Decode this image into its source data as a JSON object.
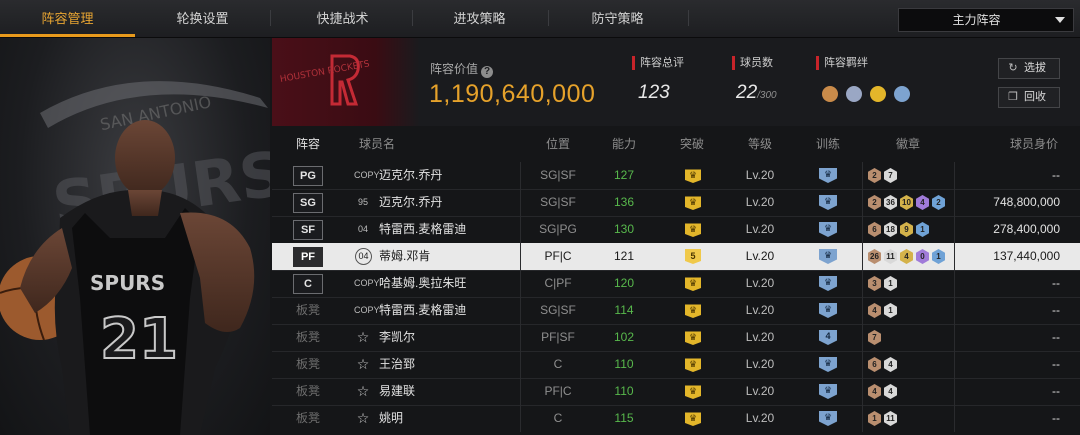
{
  "tabs": [
    {
      "label": "阵容管理",
      "active": true
    },
    {
      "label": "轮换设置"
    },
    {
      "label": "快捷战术"
    },
    {
      "label": "进攻策略"
    },
    {
      "label": "防守策略"
    }
  ],
  "lineup_select": {
    "value": "主力阵容"
  },
  "team": {
    "logo_text": "HOUSTON ROCKETS",
    "value_label": "阵容价值",
    "value": "1,190,640,000",
    "overall_label": "阵容总评",
    "overall": "123",
    "players_label": "球员数",
    "players": "22",
    "players_cap": "/300",
    "bonds_label": "阵容羁绊",
    "bond_colors": [
      "#c98b4a",
      "#9aa7c4",
      "#e3b62a",
      "#7da3cf"
    ]
  },
  "buttons": {
    "select": "选拔",
    "recycle": "回收"
  },
  "table": {
    "headers": {
      "slot": "阵容",
      "player": "球员名",
      "position": "位置",
      "ability": "能力",
      "breakthrough": "突破",
      "level": "等级",
      "training": "训练",
      "badges": "徽章",
      "value": "球员身价"
    },
    "rows": [
      {
        "slot": "PG",
        "tag": "COPY",
        "name": "迈克尔.乔丹",
        "position": "SG|SF",
        "ability": "127",
        "crown": "",
        "level": "Lv.20",
        "train": "",
        "badges": [
          {
            "c": "#b98e6f",
            "t": "2"
          },
          {
            "c": "#d9d9d9",
            "t": "7"
          }
        ],
        "price": "--"
      },
      {
        "slot": "SG",
        "tag": "95",
        "name": "迈克尔.乔丹",
        "position": "SG|SF",
        "ability": "136",
        "crown": "",
        "level": "Lv.20",
        "train": "",
        "badges": [
          {
            "c": "#b98e6f",
            "t": "2"
          },
          {
            "c": "#d9d9d9",
            "t": "36"
          },
          {
            "c": "#d4b24a",
            "t": "10"
          },
          {
            "c": "#a07bd9",
            "t": "4"
          },
          {
            "c": "#6fa2d6",
            "t": "2"
          }
        ],
        "price": "748,800,000"
      },
      {
        "slot": "SF",
        "tag": "04",
        "name": "特雷西.麦格雷迪",
        "position": "SG|PG",
        "ability": "130",
        "crown": "",
        "level": "Lv.20",
        "train": "",
        "badges": [
          {
            "c": "#b98e6f",
            "t": "6"
          },
          {
            "c": "#d9d9d9",
            "t": "18"
          },
          {
            "c": "#d4b24a",
            "t": "9"
          },
          {
            "c": "#6fa2d6",
            "t": "1"
          }
        ],
        "price": "278,400,000"
      },
      {
        "slot": "PF",
        "tag": "04",
        "name": "蒂姆.邓肯",
        "position": "PF|C",
        "ability": "121",
        "crown": "5",
        "level": "Lv.20",
        "train": "",
        "badges": [
          {
            "c": "#b98e6f",
            "t": "26"
          },
          {
            "c": "#d9d9d9",
            "t": "11"
          },
          {
            "c": "#d4b24a",
            "t": "4"
          },
          {
            "c": "#a07bd9",
            "t": "0"
          },
          {
            "c": "#6fa2d6",
            "t": "1"
          }
        ],
        "price": "137,440,000",
        "selected": true
      },
      {
        "slot": "C",
        "tag": "COPY",
        "name": "哈基姆.奥拉朱旺",
        "position": "C|PF",
        "ability": "120",
        "crown": "",
        "level": "Lv.20",
        "train": "",
        "badges": [
          {
            "c": "#b98e6f",
            "t": "3"
          },
          {
            "c": "#d9d9d9",
            "t": "1"
          }
        ],
        "price": "--"
      },
      {
        "slot": "板凳",
        "tag": "COPY",
        "name": "特雷西.麦格雷迪",
        "position": "SG|SF",
        "ability": "114",
        "crown": "",
        "level": "Lv.20",
        "train": "",
        "badges": [
          {
            "c": "#b98e6f",
            "t": "4"
          },
          {
            "c": "#d9d9d9",
            "t": "1"
          }
        ],
        "price": "--"
      },
      {
        "slot": "板凳",
        "tag": "star",
        "name": "李凯尔",
        "position": "PF|SF",
        "ability": "102",
        "crown": "",
        "level": "Lv.20",
        "train": "4",
        "badges": [
          {
            "c": "#b98e6f",
            "t": "7"
          }
        ],
        "price": "--"
      },
      {
        "slot": "板凳",
        "tag": "star",
        "name": "王治郅",
        "position": "C",
        "ability": "110",
        "crown": "",
        "level": "Lv.20",
        "train": "",
        "badges": [
          {
            "c": "#b98e6f",
            "t": "6"
          },
          {
            "c": "#d9d9d9",
            "t": "4"
          }
        ],
        "price": "--"
      },
      {
        "slot": "板凳",
        "tag": "star",
        "name": "易建联",
        "position": "PF|C",
        "ability": "110",
        "crown": "",
        "level": "Lv.20",
        "train": "",
        "badges": [
          {
            "c": "#b98e6f",
            "t": "4"
          },
          {
            "c": "#d9d9d9",
            "t": "4"
          }
        ],
        "price": "--"
      },
      {
        "slot": "板凳",
        "tag": "star",
        "name": "姚明",
        "position": "C",
        "ability": "115",
        "crown": "",
        "level": "Lv.20",
        "train": "",
        "badges": [
          {
            "c": "#b98e6f",
            "t": "1"
          },
          {
            "c": "#d9d9d9",
            "t": "11"
          }
        ],
        "price": "--"
      }
    ]
  },
  "art": {
    "jersey_number": "21",
    "team_word": "SPURS",
    "banner_word": "SAN ANTONIO"
  }
}
